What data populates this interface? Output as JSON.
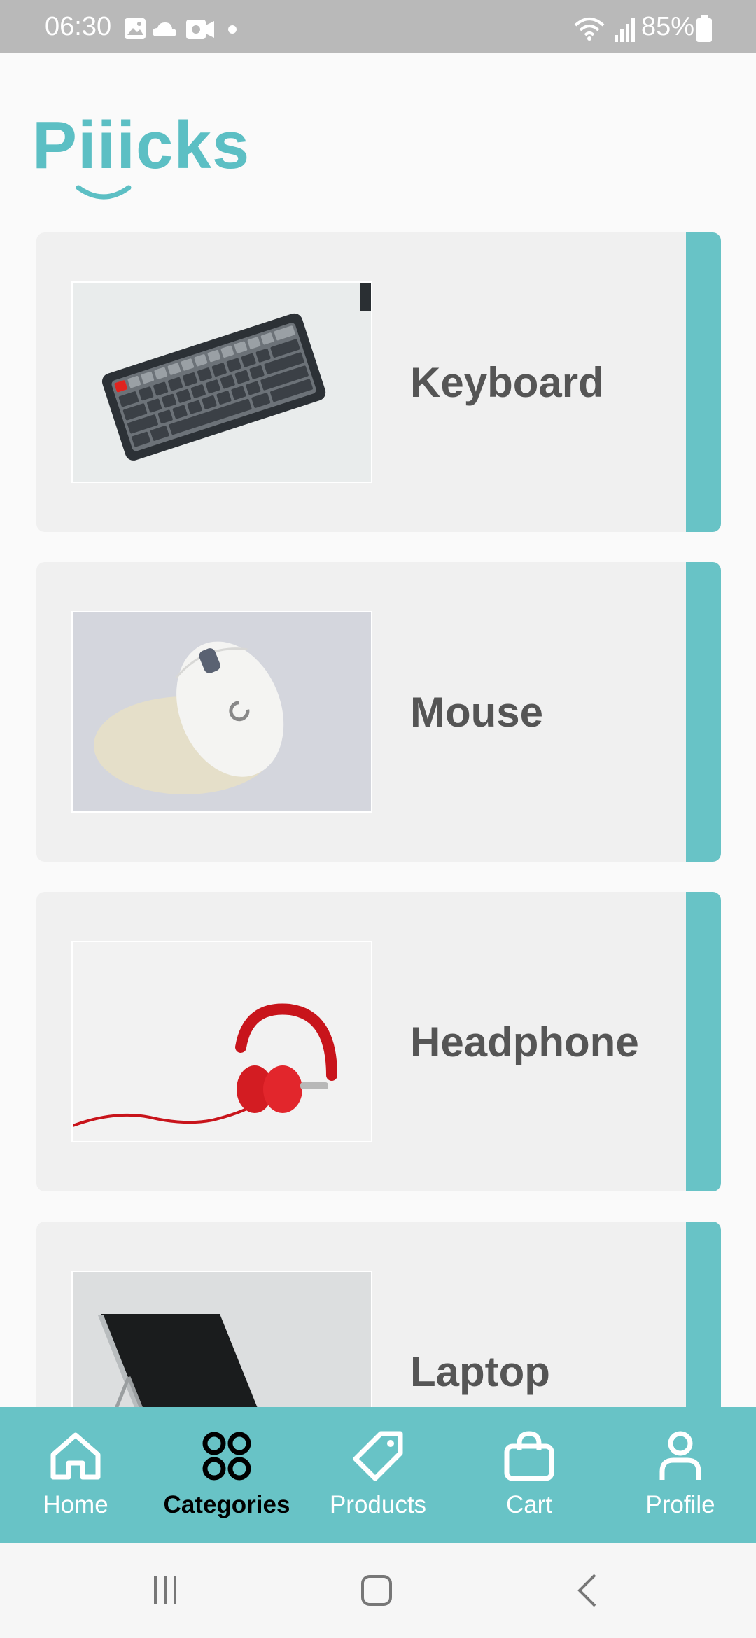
{
  "status_bar": {
    "time": "06:30",
    "battery": "85%",
    "icons": [
      "gallery-icon",
      "cloud-icon",
      "video-icon",
      "dot-icon",
      "wifi-icon",
      "signal-icon",
      "battery-icon"
    ]
  },
  "app": {
    "logo": "Piiicks",
    "accent_color": "#68c3c6"
  },
  "categories": [
    {
      "label": "Keyboard",
      "image": "keyboard-photo"
    },
    {
      "label": "Mouse",
      "image": "mouse-photo"
    },
    {
      "label": "Headphone",
      "image": "headphone-photo"
    },
    {
      "label": "Laptop",
      "image": "laptop-photo"
    }
  ],
  "bottom_nav": {
    "items": [
      {
        "label": "Home",
        "icon": "home-icon",
        "active": false
      },
      {
        "label": "Categories",
        "icon": "categories-icon",
        "active": true
      },
      {
        "label": "Products",
        "icon": "tag-icon",
        "active": false
      },
      {
        "label": "Cart",
        "icon": "bag-icon",
        "active": false
      },
      {
        "label": "Profile",
        "icon": "profile-icon",
        "active": false
      }
    ]
  },
  "system_nav": [
    "recents-icon",
    "home-button-icon",
    "back-icon"
  ]
}
